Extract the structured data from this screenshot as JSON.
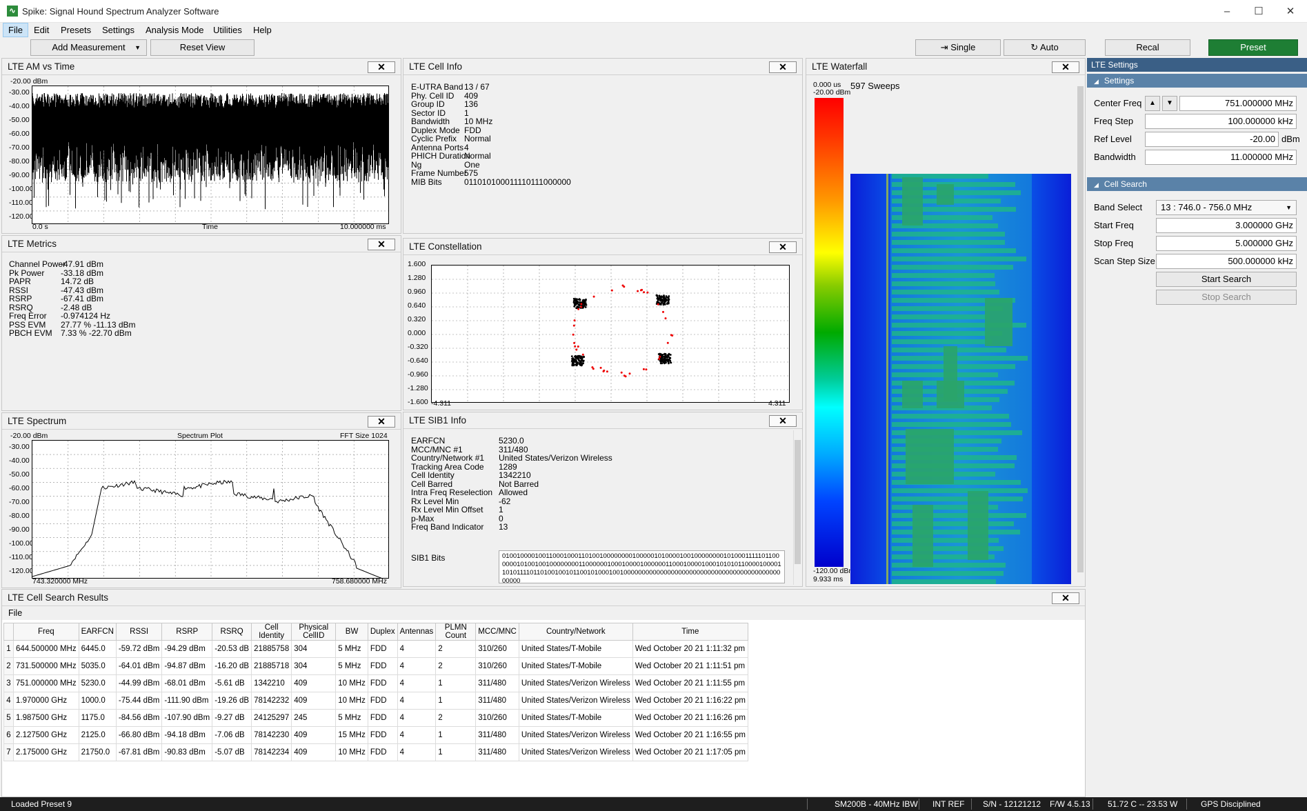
{
  "window": {
    "title": "Spike: Signal Hound Spectrum Analyzer Software",
    "icon": "spike-app-icon",
    "controls": [
      "–",
      "☐",
      "✕"
    ]
  },
  "menu": [
    "File",
    "Edit",
    "Presets",
    "Settings",
    "Analysis Mode",
    "Utilities",
    "Help"
  ],
  "toolbar": {
    "add_measurement": "Add Measurement",
    "reset_view": "Reset View",
    "single": "Single",
    "auto": "Auto",
    "recal": "Recal",
    "preset": "Preset"
  },
  "am_vs_time": {
    "title": "LTE AM vs Time",
    "ref": "-20.00 dBm",
    "yticks": [
      "-30.00",
      "-40.00",
      "-50.00",
      "-60.00",
      "-70.00",
      "-80.00",
      "-90.00",
      "-100.00",
      "-110.00",
      "-120.00"
    ],
    "x_start": "0.0 s",
    "x_mid": "Time",
    "x_end": "10.000000 ms"
  },
  "cell_info": {
    "title": "LTE Cell Info",
    "rows": [
      [
        "E-UTRA Band",
        "13 / 67"
      ],
      [
        "Phy. Cell ID",
        "409"
      ],
      [
        "Group ID",
        "136"
      ],
      [
        "Sector ID",
        "1"
      ],
      [
        "Bandwidth",
        "10 MHz"
      ],
      [
        "Duplex Mode",
        "FDD"
      ],
      [
        "Cyclic Prefix",
        "Normal"
      ],
      [
        "Antenna Ports",
        "4"
      ],
      [
        "PHICH Duration",
        "Normal"
      ],
      [
        "Ng",
        "One"
      ],
      [
        "Frame Number",
        "575"
      ],
      [
        "MIB Bits",
        "011010100011110111000000"
      ]
    ]
  },
  "metrics": {
    "title": "LTE Metrics",
    "rows": [
      [
        "Channel Power",
        "-47.91 dBm"
      ],
      [
        "Pk Power",
        "-33.18 dBm"
      ],
      [
        "PAPR",
        "14.72 dB"
      ],
      [
        "RSSI",
        "-47.43 dBm"
      ],
      [
        "RSRP",
        "-67.41 dBm"
      ],
      [
        "RSRQ",
        "-2.48 dB"
      ],
      [
        "Freq Error",
        "-0.974124 Hz"
      ],
      [
        "PSS EVM",
        "27.77 % -11.13 dBm"
      ],
      [
        "PBCH EVM",
        "7.33 % -22.70 dBm"
      ]
    ]
  },
  "constellation": {
    "title": "LTE Constellation",
    "yticks": [
      "1.600",
      "1.280",
      "0.960",
      "0.640",
      "0.320",
      "0.000",
      "-0.320",
      "-0.640",
      "-0.960",
      "-1.280",
      "-1.600"
    ],
    "x_start": "-4.311",
    "x_end": "4.311"
  },
  "spectrum": {
    "title": "LTE Spectrum",
    "ref": "-20.00 dBm",
    "center_label": "Spectrum Plot",
    "fft": "FFT Size 1024",
    "yticks": [
      "-30.00",
      "-40.00",
      "-50.00",
      "-60.00",
      "-70.00",
      "-80.00",
      "-90.00",
      "-100.00",
      "-110.00",
      "-120.00"
    ],
    "x_start": "743.320000 MHz",
    "x_end": "758.680000 MHz"
  },
  "sib1": {
    "title": "LTE SIB1 Info",
    "rows": [
      [
        "EARFCN",
        "5230.0"
      ],
      [
        "MCC/MNC #1",
        "311/480"
      ],
      [
        "Country/Network #1",
        "United States/Verizon Wireless"
      ],
      [
        "Tracking Area Code",
        "1289"
      ],
      [
        "Cell Identity",
        "1342210"
      ],
      [
        "Cell Barred",
        "Not Barred"
      ],
      [
        "Intra Freq Reselection",
        "Allowed"
      ],
      [
        "Rx Level Min",
        "-62"
      ],
      [
        "Rx Level Min Offset",
        "1"
      ],
      [
        "p-Max",
        "0"
      ],
      [
        "Freq Band Indicator",
        "13"
      ]
    ],
    "bits_label": "SIB1 Bits",
    "bits": [
      "010010000100110001000110100100000000100000101000010010000000010100011",
      "11101100000010100100100000000110000001000100001000000110001000010001010",
      "10110000100001101011110110100100101100101000100100000000000000000000000",
      "0000000000000000000000000"
    ]
  },
  "waterfall": {
    "title": "LTE Waterfall",
    "top_time": "0.000 us",
    "top_level": "-20.00 dBm",
    "sweeps": "597 Sweeps",
    "bottom_level": "-120.00 dBm",
    "bottom_time": "9.933 ms"
  },
  "settings": {
    "title": "LTE Settings",
    "section1": "Settings",
    "center_freq_label": "Center Freq",
    "center_freq": "751.000000 MHz",
    "freq_step_label": "Freq Step",
    "freq_step": "100.000000 kHz",
    "ref_level_label": "Ref Level",
    "ref_level": "-20.00",
    "ref_unit": "dBm",
    "bandwidth_label": "Bandwidth",
    "bandwidth": "11.000000 MHz",
    "section2": "Cell Search",
    "band_select_label": "Band Select",
    "band_select": "13 : 746.0 - 756.0 MHz",
    "start_freq_label": "Start Freq",
    "start_freq": "3.000000 GHz",
    "stop_freq_label": "Stop Freq",
    "stop_freq": "5.000000 GHz",
    "scan_step_label": "Scan Step Size",
    "scan_step": "500.000000 kHz",
    "start_search": "Start Search",
    "stop_search": "Stop Search"
  },
  "results": {
    "title": "LTE Cell Search Results",
    "menu": "File",
    "columns": [
      "Freq",
      "EARFCN",
      "RSSI",
      "RSRP",
      "RSRQ",
      "Cell Identity",
      "Physical CellID",
      "BW",
      "Duplex",
      "Antennas",
      "PLMN Count",
      "MCC/MNC",
      "Country/Network",
      "Time"
    ],
    "rows": [
      [
        "1",
        "644.500000 MHz",
        "6445.0",
        "-59.72 dBm",
        "-94.29 dBm",
        "-20.53 dB",
        "21885758",
        "304",
        "5 MHz",
        "FDD",
        "4",
        "2",
        "310/260",
        "United States/T-Mobile",
        "Wed October 20 21 1:11:32 pm"
      ],
      [
        "2",
        "731.500000 MHz",
        "5035.0",
        "-64.01 dBm",
        "-94.87 dBm",
        "-16.20 dB",
        "21885718",
        "304",
        "5 MHz",
        "FDD",
        "4",
        "2",
        "310/260",
        "United States/T-Mobile",
        "Wed October 20 21 1:11:51 pm"
      ],
      [
        "3",
        "751.000000 MHz",
        "5230.0",
        "-44.99 dBm",
        "-68.01 dBm",
        "-5.61 dB",
        "1342210",
        "409",
        "10 MHz",
        "FDD",
        "4",
        "1",
        "311/480",
        "United States/Verizon Wireless",
        "Wed October 20 21 1:11:55 pm"
      ],
      [
        "4",
        "1.970000 GHz",
        "1000.0",
        "-75.44 dBm",
        "-111.90 dBm",
        "-19.26 dB",
        "78142232",
        "409",
        "10 MHz",
        "FDD",
        "4",
        "1",
        "311/480",
        "United States/Verizon Wireless",
        "Wed October 20 21 1:16:22 pm"
      ],
      [
        "5",
        "1.987500 GHz",
        "1175.0",
        "-84.56 dBm",
        "-107.90 dBm",
        "-9.27 dB",
        "24125297",
        "245",
        "5 MHz",
        "FDD",
        "4",
        "2",
        "310/260",
        "United States/T-Mobile",
        "Wed October 20 21 1:16:26 pm"
      ],
      [
        "6",
        "2.127500 GHz",
        "2125.0",
        "-66.80 dBm",
        "-94.18 dBm",
        "-7.06 dB",
        "78142230",
        "409",
        "15 MHz",
        "FDD",
        "4",
        "1",
        "311/480",
        "United States/Verizon Wireless",
        "Wed October 20 21 1:16:55 pm"
      ],
      [
        "7",
        "2.175000 GHz",
        "21750.0",
        "-67.81 dBm",
        "-90.83 dBm",
        "-5.07 dB",
        "78142234",
        "409",
        "10 MHz",
        "FDD",
        "4",
        "1",
        "311/480",
        "United States/Verizon Wireless",
        "Wed October 20 21 1:17:05 pm"
      ]
    ]
  },
  "status": {
    "left": "Loaded Preset 9",
    "device": "SM200B - 40MHz IBW",
    "ref": "INT REF",
    "serial": "S/N - 12121212",
    "fw": "F/W 4.5.13",
    "temp": "51.72 C -- 23.53 W",
    "gps": "GPS Disciplined"
  }
}
